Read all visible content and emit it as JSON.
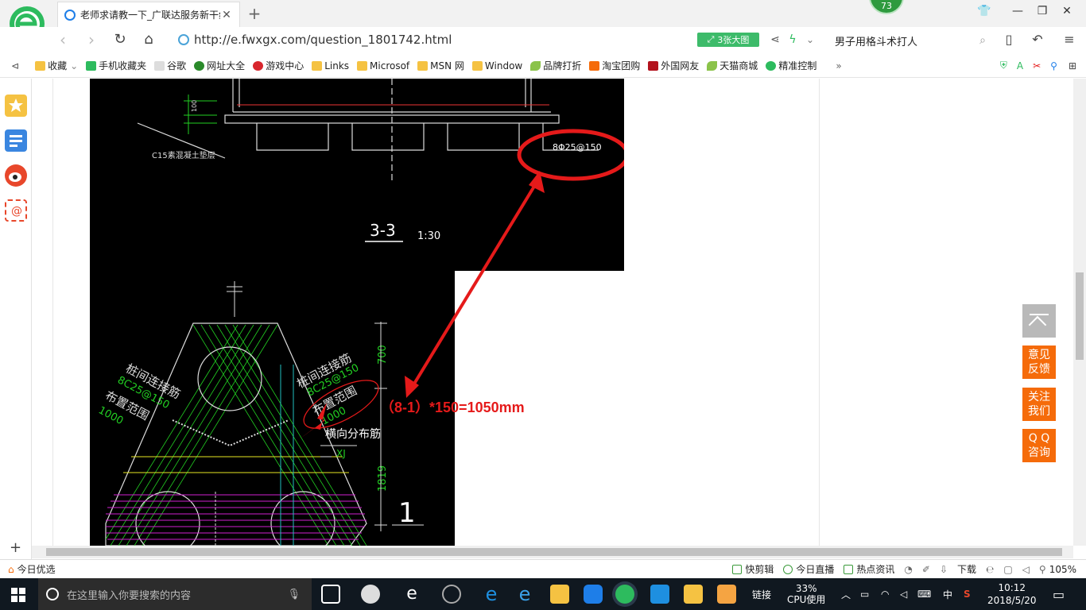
{
  "browser": {
    "tab_title": "老师求请教一下_广联达服务新干线",
    "new_tab": "+",
    "badge_count": "73",
    "url": "http://e.fwxgx.com/question_1801742.html",
    "big_image_label": "3张大图",
    "search_text": "男子用格斗术打人"
  },
  "bookmarks": [
    {
      "label": "收藏",
      "icon": "star-icon"
    },
    {
      "label": "手机收藏夹",
      "icon": "phone-icon"
    },
    {
      "label": "谷歌",
      "icon": "page-icon"
    },
    {
      "label": "网址大全",
      "icon": "globe-icon"
    },
    {
      "label": "游戏中心",
      "icon": "game-icon"
    },
    {
      "label": "Links",
      "icon": "folder-icon"
    },
    {
      "label": "Microsof",
      "icon": "folder-icon"
    },
    {
      "label": "MSN 网",
      "icon": "folder-icon"
    },
    {
      "label": "Window",
      "icon": "folder-icon"
    },
    {
      "label": "品牌打折",
      "icon": "leaf-icon"
    },
    {
      "label": "淘宝团购",
      "icon": "taobao-icon"
    },
    {
      "label": "外国网友",
      "icon": "flag-icon"
    },
    {
      "label": "天猫商城",
      "icon": "leaf-icon"
    },
    {
      "label": "精准控制",
      "icon": "chat-icon"
    }
  ],
  "drawing": {
    "rebar_top": "8Φ25@150",
    "section_label": "3-3",
    "section_scale": "1:30",
    "concrete_note": "C15素混凝土垫层",
    "left_label1": "桩间连接筋",
    "left_label2": "8C25@150",
    "left_label3": "布置范围",
    "left_label4": "1000",
    "right_label1": "桩间连接筋",
    "right_label2": "8C25@150",
    "right_label3": "布置范围",
    "right_label4": "1000",
    "dist_label": "横向分布筋",
    "xj_label": "XJ",
    "dim_700": "700",
    "dim_1819": "1819",
    "dim_100": "100",
    "section_number": "1",
    "annotation": "（8-1）*150=1050mm"
  },
  "floating": {
    "feedback": "意见反馈",
    "follow": "关注我们",
    "qq": "Q Q咨询"
  },
  "status": {
    "today_pick": "今日优选",
    "quick_edit": "快剪辑",
    "live": "今日直播",
    "hot_news": "热点资讯",
    "download": "下载",
    "zoom": "105%"
  },
  "taskbar": {
    "search_placeholder": "在这里输入你要搜索的内容",
    "link_label": "链接",
    "cpu_percent": "33%",
    "cpu_label": "CPU使用",
    "ime": "中",
    "time": "10:12",
    "date": "2018/5/20"
  },
  "colors": {
    "accent_green": "#3dbb6a",
    "float_orange": "#f56b0a",
    "annotation_red": "#e51a1a",
    "cad_green": "#22d022",
    "cad_magenta": "#d020d0"
  }
}
